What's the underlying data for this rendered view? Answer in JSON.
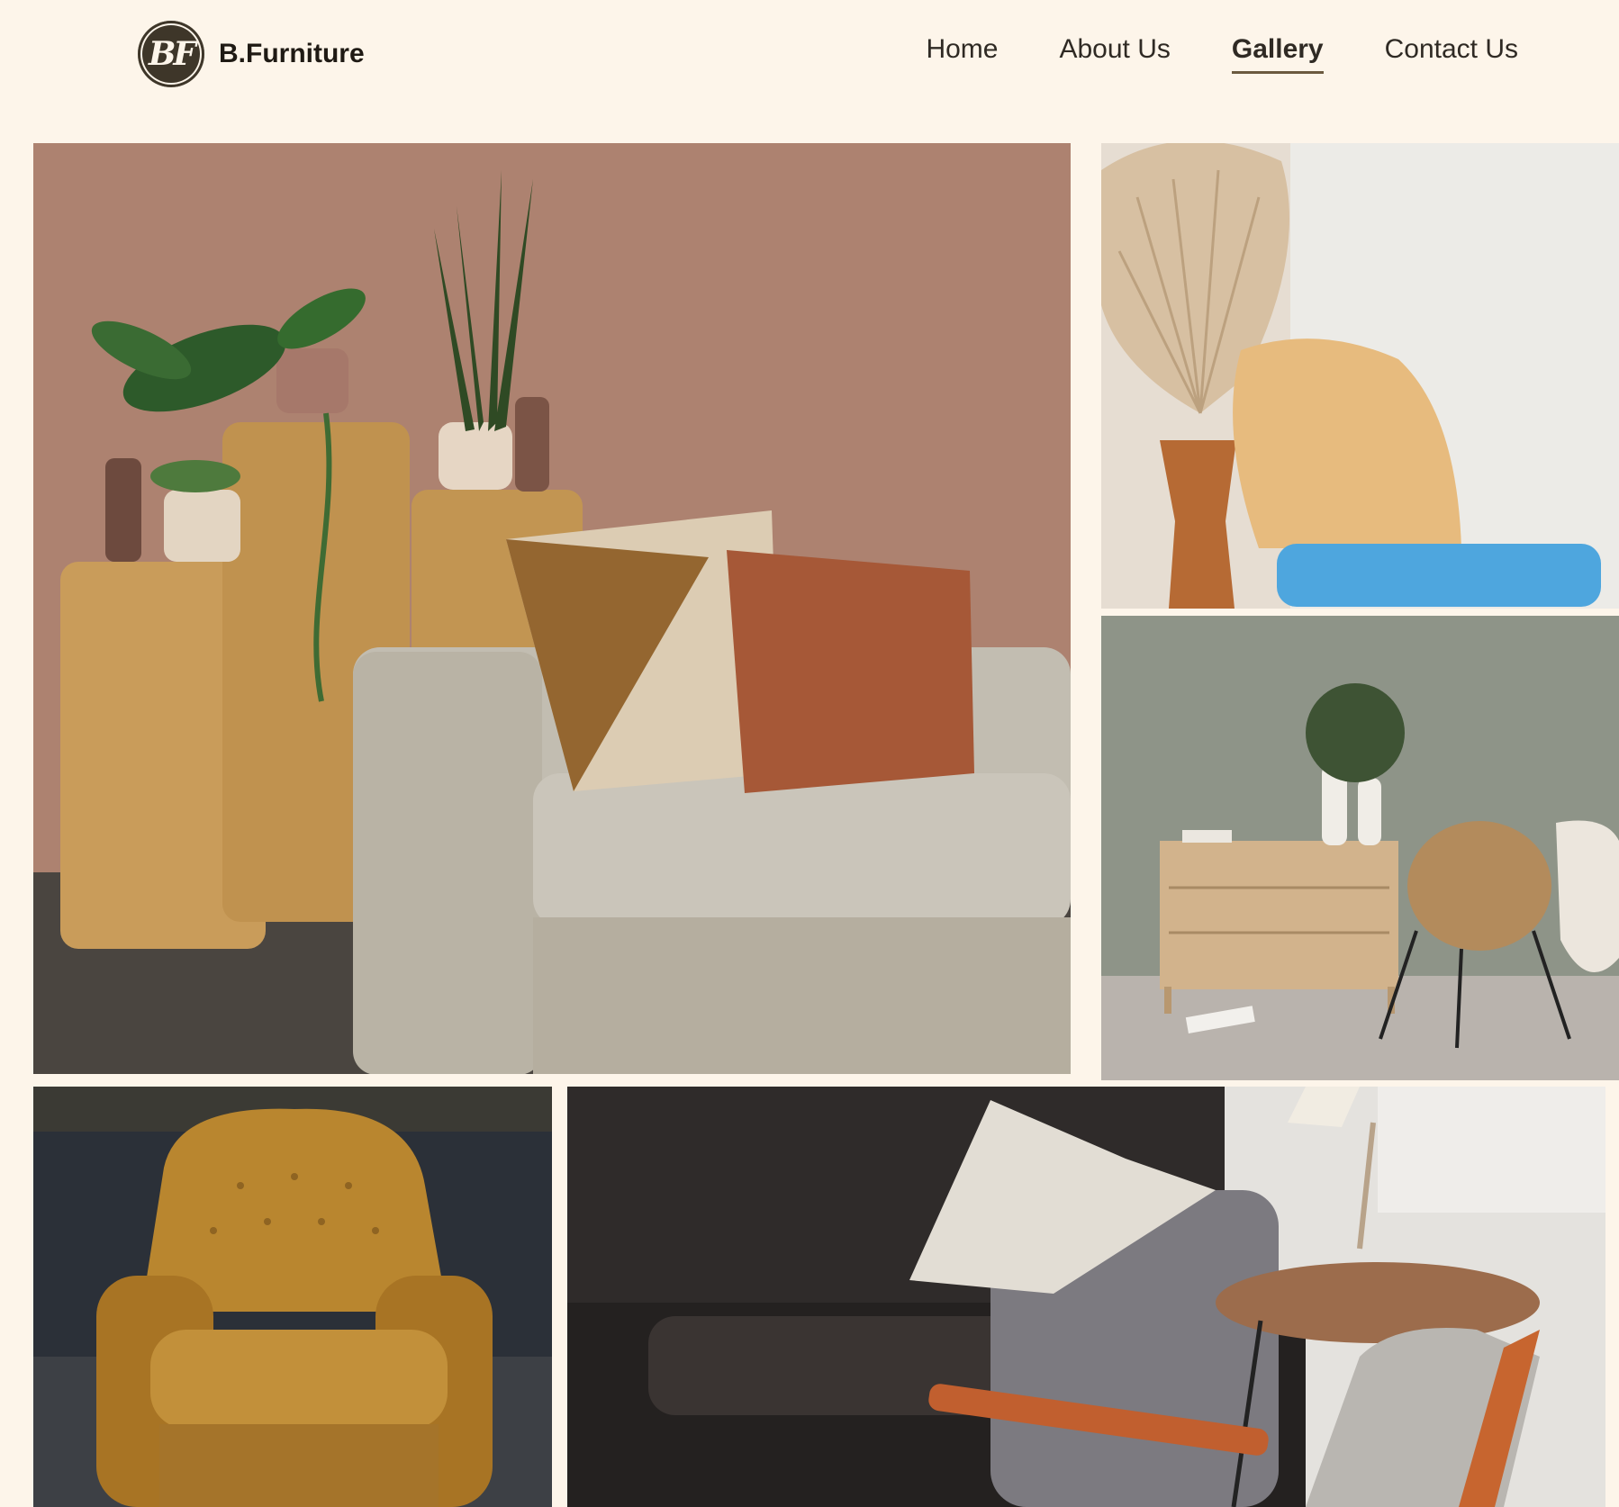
{
  "brand": {
    "logo_text": "BF",
    "name": "B.Furniture"
  },
  "nav": {
    "items": [
      {
        "label": "Home",
        "active": false
      },
      {
        "label": "About Us",
        "active": false
      },
      {
        "label": "Gallery",
        "active": true
      },
      {
        "label": "Contact Us",
        "active": false
      }
    ]
  },
  "gallery": {
    "photos": [
      {
        "subject": "sofa-with-plants-and-pedestals"
      },
      {
        "subject": "rattan-chair-with-dried-palm"
      },
      {
        "subject": "dresser-and-wicker-chair"
      },
      {
        "subject": "tufted-mustard-armchair"
      },
      {
        "subject": "dark-sofa-with-side-table"
      }
    ]
  },
  "colors": {
    "background": "#fdf5ea",
    "text": "#2c2620",
    "accent": "#6b5a3f"
  }
}
